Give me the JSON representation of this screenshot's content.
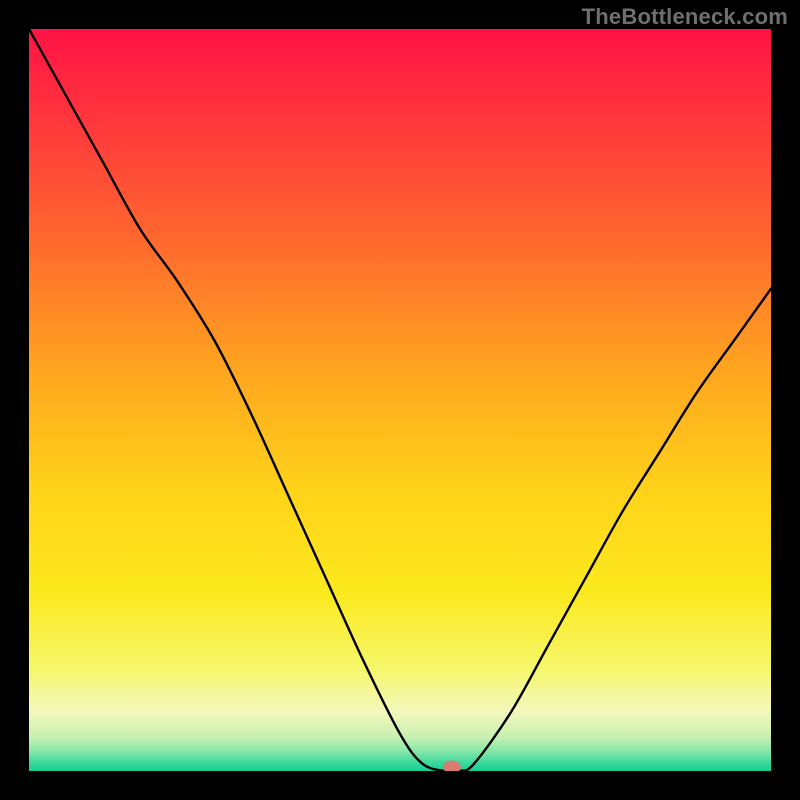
{
  "watermark": "TheBottleneck.com",
  "colors": {
    "frame_bg": "#000000",
    "curve_stroke": "#000000",
    "marker_fill": "#d97b72",
    "watermark": "#6f6f6f"
  },
  "gradient_stops": [
    {
      "offset": 0.0,
      "color": "#ff1345"
    },
    {
      "offset": 0.14,
      "color": "#ff3b3b"
    },
    {
      "offset": 0.3,
      "color": "#ff6d2d"
    },
    {
      "offset": 0.46,
      "color": "#ffa51f"
    },
    {
      "offset": 0.62,
      "color": "#ffd21a"
    },
    {
      "offset": 0.76,
      "color": "#fbe91d"
    },
    {
      "offset": 0.86,
      "color": "#f6f669"
    },
    {
      "offset": 0.92,
      "color": "#f3f8bc"
    },
    {
      "offset": 0.955,
      "color": "#c7f0b0"
    },
    {
      "offset": 0.975,
      "color": "#7fe6a8"
    },
    {
      "offset": 0.99,
      "color": "#36d89c"
    },
    {
      "offset": 1.0,
      "color": "#18cf90"
    }
  ],
  "chart_data": {
    "type": "line",
    "title": "",
    "xlabel": "",
    "ylabel": "",
    "xlim": [
      0,
      100
    ],
    "ylim": [
      0,
      100
    ],
    "x": [
      0,
      5,
      10,
      15,
      20,
      25,
      30,
      35,
      40,
      45,
      50,
      53,
      56,
      58,
      60,
      65,
      70,
      75,
      80,
      85,
      90,
      95,
      100
    ],
    "values": [
      100,
      91,
      82,
      73,
      66,
      58,
      48,
      37,
      26,
      15,
      5,
      1,
      0,
      0,
      1,
      8,
      17,
      26,
      35,
      43,
      51,
      58,
      65
    ],
    "marker": {
      "x": 57,
      "y": 0
    },
    "grid": false,
    "legend": false
  }
}
